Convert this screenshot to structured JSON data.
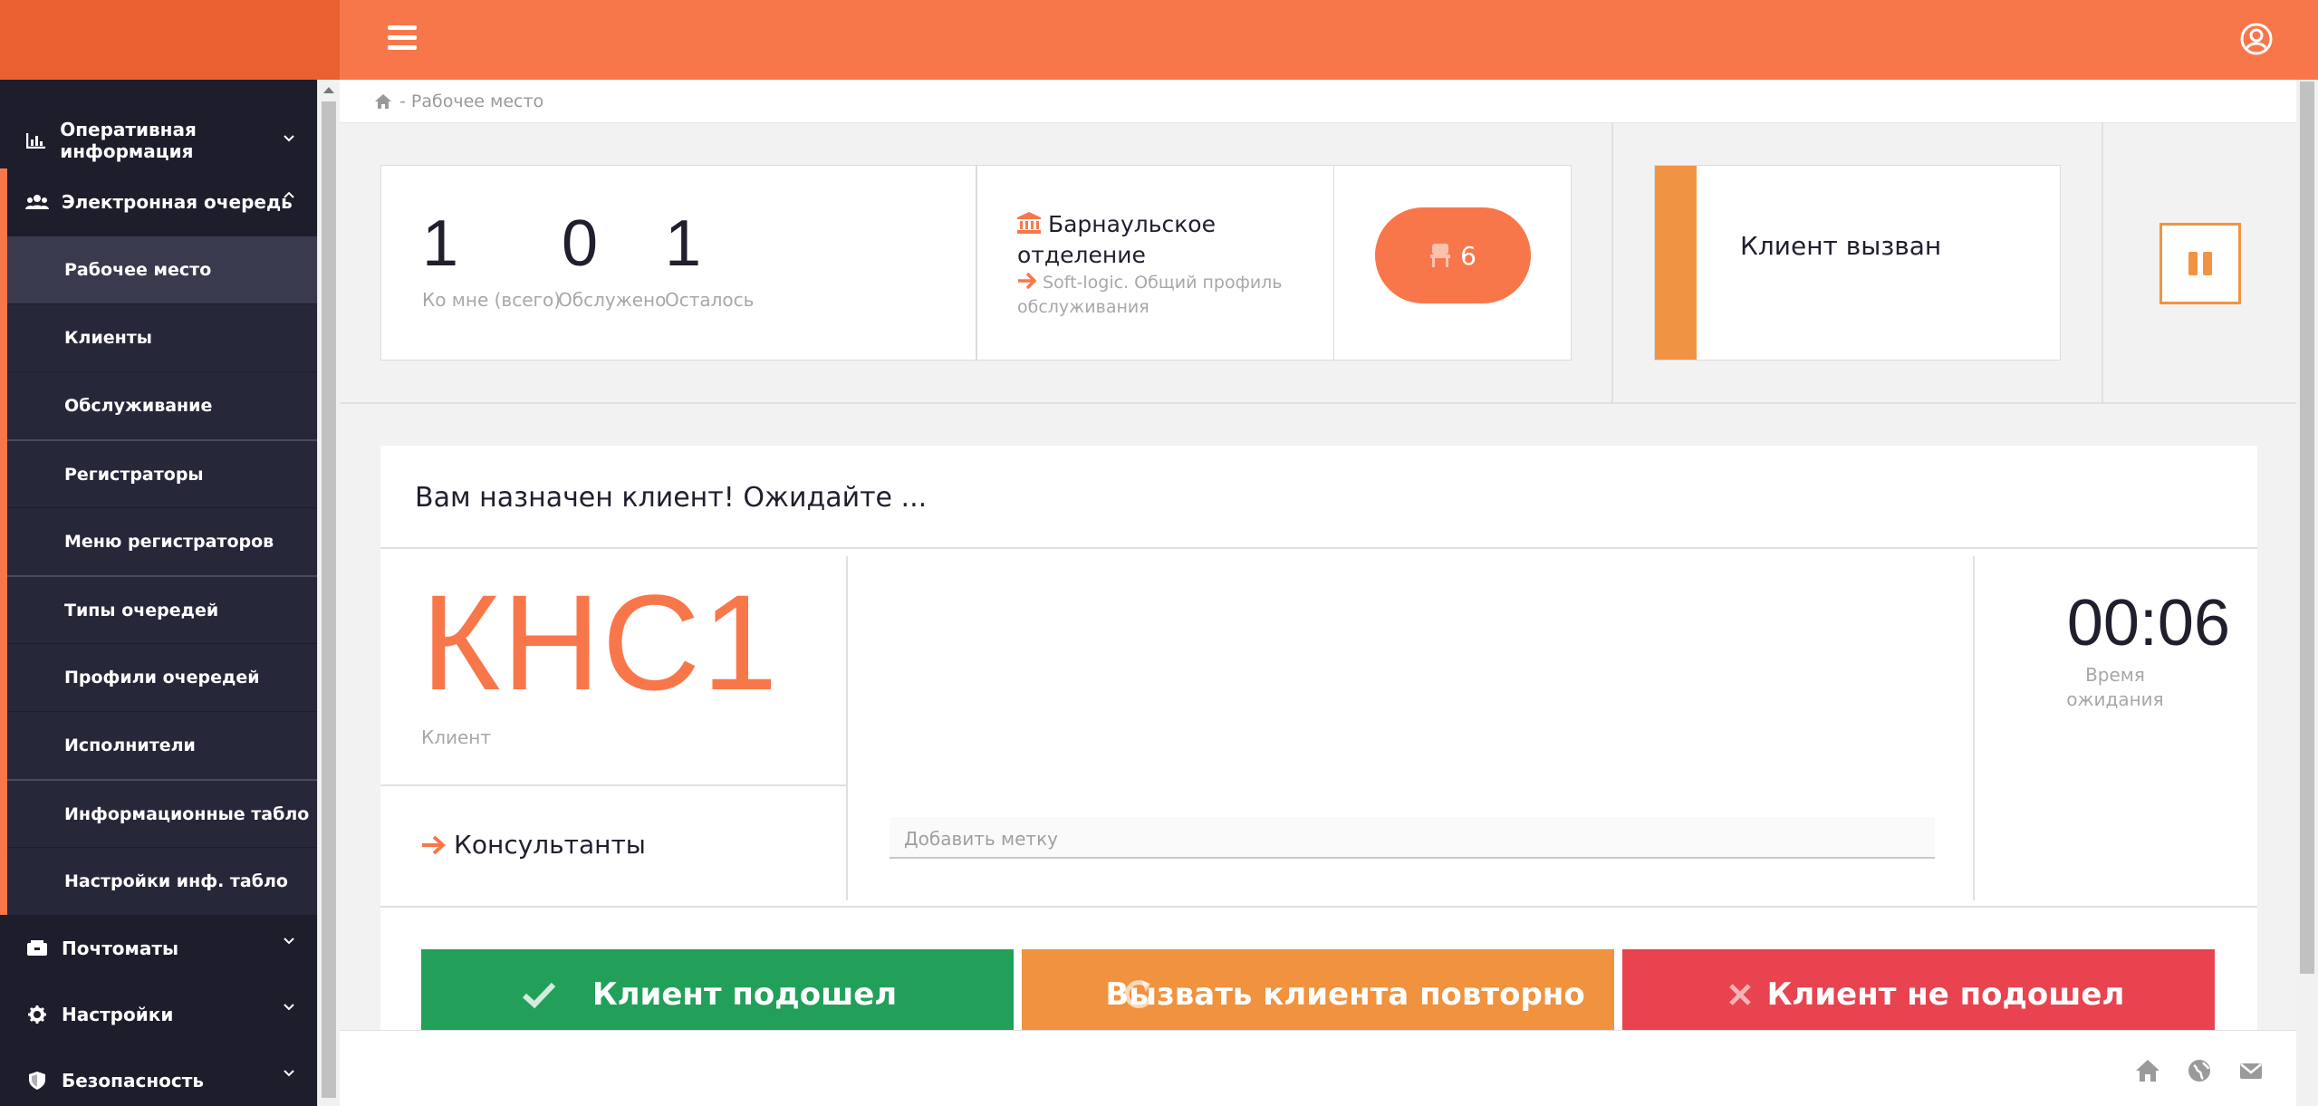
{
  "breadcrumb": {
    "current": "- Рабочее место"
  },
  "sidebar": {
    "top_items": [
      {
        "label": "Оперативная информация",
        "icon": "chart-icon"
      },
      {
        "label": "Электронная очередь",
        "icon": "users-icon"
      }
    ],
    "queue_items": [
      "Рабочее место",
      "Клиенты",
      "Обслуживание",
      "Регистраторы",
      "Меню регистраторов",
      "Типы очередей",
      "Профили очередей",
      "Исполнители",
      "Информационные табло",
      "Настройки инф. табло"
    ],
    "bottom_items": [
      {
        "label": "Почтоматы",
        "icon": "inbox-icon"
      },
      {
        "label": "Настройки",
        "icon": "gear-icon"
      },
      {
        "label": "Безопасность",
        "icon": "shield-icon"
      }
    ]
  },
  "stats": [
    {
      "value": "1",
      "label": "Ко мне (всего)"
    },
    {
      "value": "0",
      "label": "Обслужено"
    },
    {
      "value": "1",
      "label": "Осталось"
    }
  ],
  "branch": {
    "name_line1": "Барнаульское",
    "name_line2": "отделение",
    "profile_line1": "Soft-logic. Общий профиль",
    "profile_line2": "обслуживания"
  },
  "waiting_count": "6",
  "status_text": "Клиент вызван",
  "card": {
    "heading": "Вам назначен клиент! Ожидайте ...",
    "client_code": "КНС1",
    "client_label": "Клиент",
    "consultants": "Консультанты",
    "tag_placeholder": "Добавить метку",
    "timer": "00:06",
    "timer_label_line1": "Время",
    "timer_label_line2": "ожидания"
  },
  "buttons": {
    "arrived": "Клиент подошел",
    "recall": "Вызвать клиента повторно",
    "not_arrived": "Клиент не подошел"
  },
  "colors": {
    "accent": "#f8774a",
    "sidebar_bg": "#1d1d2c",
    "green": "#22a05a",
    "orange": "#f0923e",
    "red": "#e8434f"
  }
}
